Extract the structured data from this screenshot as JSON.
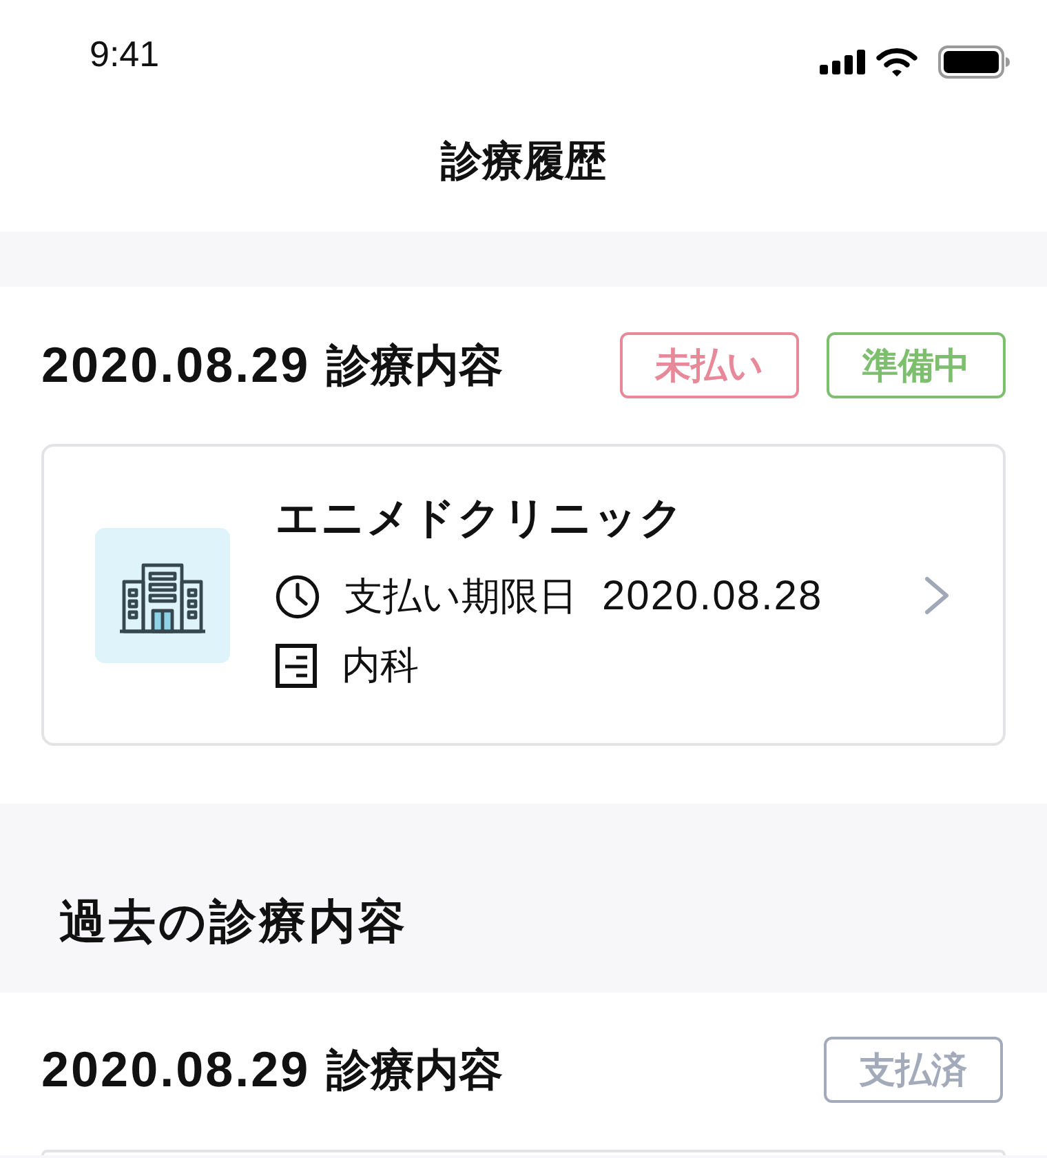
{
  "status_bar": {
    "time": "9:41"
  },
  "nav": {
    "title": "診療履歴"
  },
  "current": {
    "records": [
      {
        "date": "2020.08.29",
        "label": "診療内容",
        "badges": [
          {
            "text": "未払い",
            "color": "#e8899a"
          },
          {
            "text": "準備中",
            "color": "#7dbf6e"
          }
        ],
        "clinic": {
          "name": "エニメドクリニック",
          "due_label": "支払い期限日",
          "due_date": "2020.08.28",
          "department": "内科"
        }
      }
    ]
  },
  "past": {
    "title": "過去の診療内容",
    "records": [
      {
        "date": "2020.08.29",
        "label": "診療内容",
        "badges": [
          {
            "text": "支払済",
            "color": "#a3abbb"
          }
        ]
      }
    ]
  }
}
